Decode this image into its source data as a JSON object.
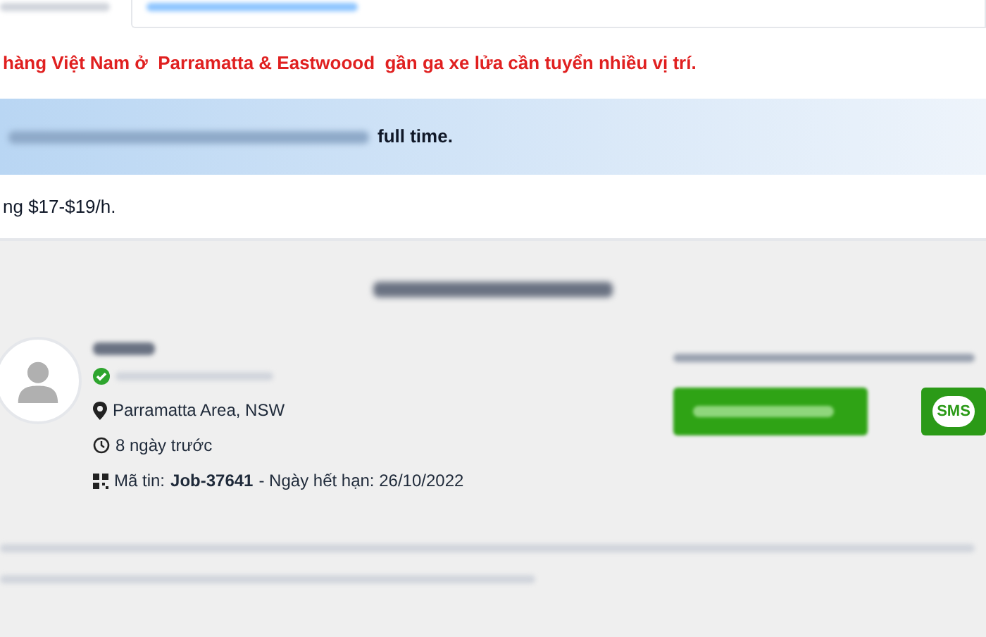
{
  "headline": "hàng Việt Nam ở  Parramatta & Eastwoood  gần ga xe lửa cần tuyển nhiều vị trí.",
  "highlight": {
    "emphasis": "full time."
  },
  "wage": "ng $17-$19/h.",
  "contact": {
    "location": "Parramatta Area, NSW",
    "posted": "8 ngày trước",
    "job_code_label": "Mã tin:",
    "job_code": "Job-37641",
    "expiry": "- Ngày hết hạn: 26/10/2022",
    "sms": "SMS"
  }
}
